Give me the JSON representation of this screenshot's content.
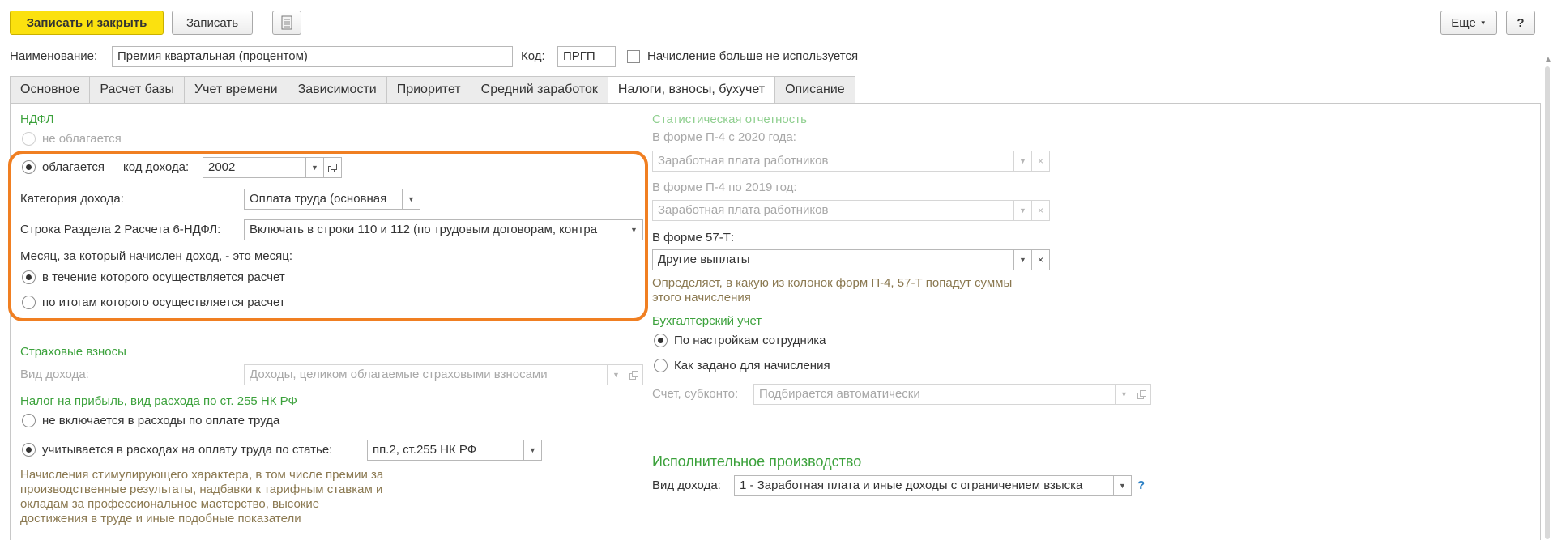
{
  "toolbar": {
    "save_close": "Записать и закрыть",
    "save": "Записать",
    "more": "Еще",
    "help": "?"
  },
  "header": {
    "name_label": "Наименование:",
    "name_value": "Премия квартальная (процентом)",
    "code_label": "Код:",
    "code_value": "ПРГП",
    "unused_label": "Начисление больше не используется"
  },
  "tabs": [
    {
      "label": "Основное"
    },
    {
      "label": "Расчет базы"
    },
    {
      "label": "Учет времени"
    },
    {
      "label": "Зависимости"
    },
    {
      "label": "Приоритет"
    },
    {
      "label": "Средний заработок"
    },
    {
      "label": "Налоги, взносы, бухучет"
    },
    {
      "label": "Описание"
    }
  ],
  "ndfl": {
    "title": "НДФЛ",
    "not_taxed": "не облагается",
    "taxed": "облагается",
    "income_code_label": "код дохода:",
    "income_code": "2002",
    "category_label": "Категория дохода:",
    "category_value": "Оплата труда (основная",
    "row_label": "Строка Раздела 2 Расчета 6-НДФЛ:",
    "row_value": "Включать в строки 110 и 112 (по трудовым договорам, контра",
    "month_label": "Месяц, за который начислен доход, - это месяц:",
    "month_option1": "в течение которого осуществляется расчет",
    "month_option2": "по итогам которого осуществляется расчет"
  },
  "insurance": {
    "title": "Страховые взносы",
    "income_kind_label": "Вид дохода:",
    "income_kind_value": "Доходы, целиком облагаемые страховыми взносами"
  },
  "profit_tax": {
    "title": "Налог на прибыль, вид расхода по ст. 255 НК РФ",
    "option1": "не включается в расходы по оплате труда",
    "option2": "учитывается в расходах на оплату труда по статье:",
    "article_value": "пп.2, ст.255 НК РФ",
    "hint_line1": "Начисления стимулирующего характера, в том числе премии за",
    "hint_line2": "производственные результаты, надбавки к тарифным ставкам и",
    "hint_line3": "окладам за профессиональное мастерство, высокие",
    "hint_line4": "достижения в труде и иные подобные показатели"
  },
  "statistics": {
    "title": "Статистическая отчетность",
    "p4_2020_label": "В форме П-4 с 2020 года:",
    "p4_2020_value": "Заработная плата работников",
    "p4_2019_label": "В форме П-4 по 2019 год:",
    "p4_2019_value": "Заработная плата работников",
    "f57_label": "В форме 57-Т:",
    "f57_value": "Другие выплаты",
    "hint_line1": "Определяет, в какую из колонок форм П-4, 57-Т попадут суммы",
    "hint_line2": "этого начисления"
  },
  "accounting": {
    "title": "Бухгалтерский учет",
    "option1": "По настройкам сотрудника",
    "option2": "Как задано для начисления",
    "account_label": "Счет, субконто:",
    "account_value": "Подбирается автоматически"
  },
  "enforcement": {
    "title": "Исполнительное производство",
    "income_kind_label": "Вид дохода:",
    "income_kind_value": "1 - Заработная плата и иные доходы с ограничением взыска",
    "help": "?"
  },
  "colors": {
    "primary_button": "#fbe10f",
    "section_green": "#3ba13b",
    "hint_brown": "#8a7850",
    "highlight_orange": "#f07f22"
  }
}
